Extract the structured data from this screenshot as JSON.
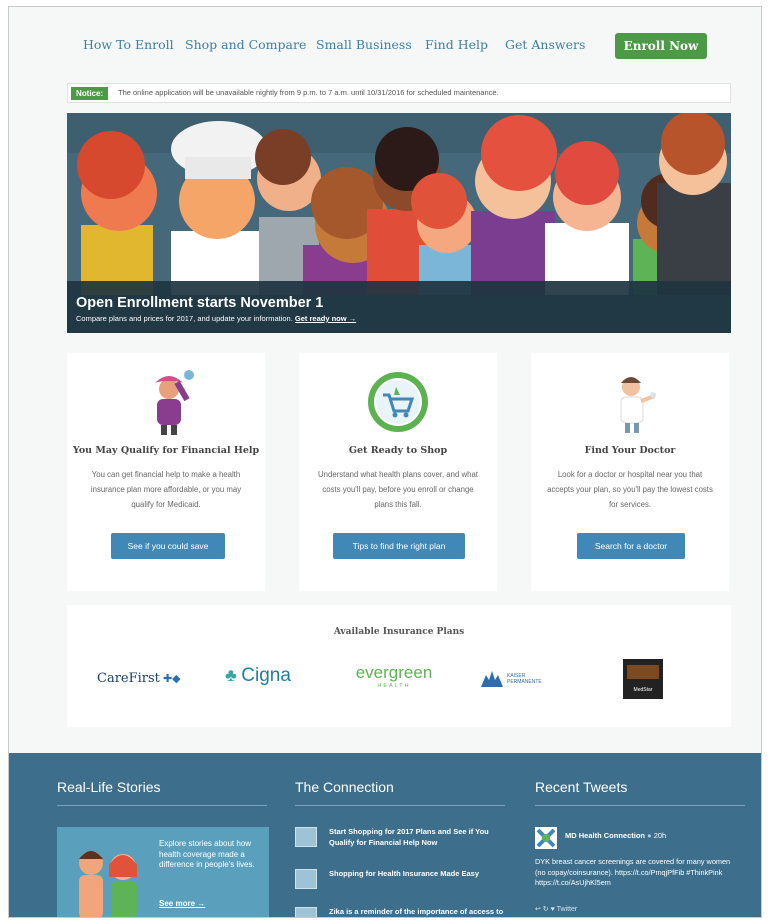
{
  "nav": {
    "items": [
      "How To Enroll",
      "Shop and Compare",
      "Small Business",
      "Find Help",
      "Get Answers"
    ],
    "enroll_label": "Enroll Now"
  },
  "notice": {
    "tag": "Notice:",
    "text": "The online application will be unavailable nightly from 9 p.m. to 7 a.m. until 10/31/2016 for scheduled maintenance."
  },
  "hero": {
    "title": "Open Enrollment starts November 1",
    "subtitle": "Compare plans and prices for 2017, and update your information.",
    "link": "Get ready now →"
  },
  "cards": [
    {
      "title": "You May Qualify for Financial Help",
      "body": "You can get financial help to make a health insurance plan more affordable, or you may qualify for Medicaid.",
      "button": "See if you could save",
      "icon": "woman-waving-icon"
    },
    {
      "title": "Get Ready to Shop",
      "body": "Understand what health plans cover, and what costs you'll pay, before you enroll or change plans this fall.",
      "button": "Tips to find the right plan",
      "icon": "shopping-cart-icon"
    },
    {
      "title": "Find Your Doctor",
      "body": "Look for a doctor or hospital near you that accepts your plan, so you'll pay the lowest costs for services.",
      "button": "Search for a doctor",
      "icon": "doctor-icon"
    }
  ],
  "plans": {
    "title": "Available Insurance Plans",
    "logos": [
      "CareFirst",
      "Cigna",
      "evergreen",
      "HEALTH",
      "KAISER PERMANENTE",
      "MedStar"
    ]
  },
  "footer": {
    "stories": {
      "title": "Real-Life Stories",
      "text": "Explore stories about how health coverage made a difference in people's lives.",
      "more": "See more →"
    },
    "connection": {
      "title": "The Connection",
      "items": [
        "Start Shopping for 2017 Plans and See if You Qualify for Financial Help Now",
        "Shopping for Health Insurance Made Easy",
        "Zika is a reminder of the importance of access to health care"
      ]
    },
    "tweets": {
      "title": "Recent Tweets",
      "name": "MD Health Connection",
      "time": "20h",
      "text": "DYK breast cancer screenings are covered for many women (no copay/coinsurance). https://t.co/PmqjPfFib #ThinkPink https://t.co/AsUjhKl5em",
      "actions": "↩  ↻  ♥  Twitter"
    }
  },
  "colors": {
    "green": "#4c9a45",
    "blue_button": "#3f88b8",
    "link": "#3f7fa6",
    "footer": "#3d6e8c"
  }
}
